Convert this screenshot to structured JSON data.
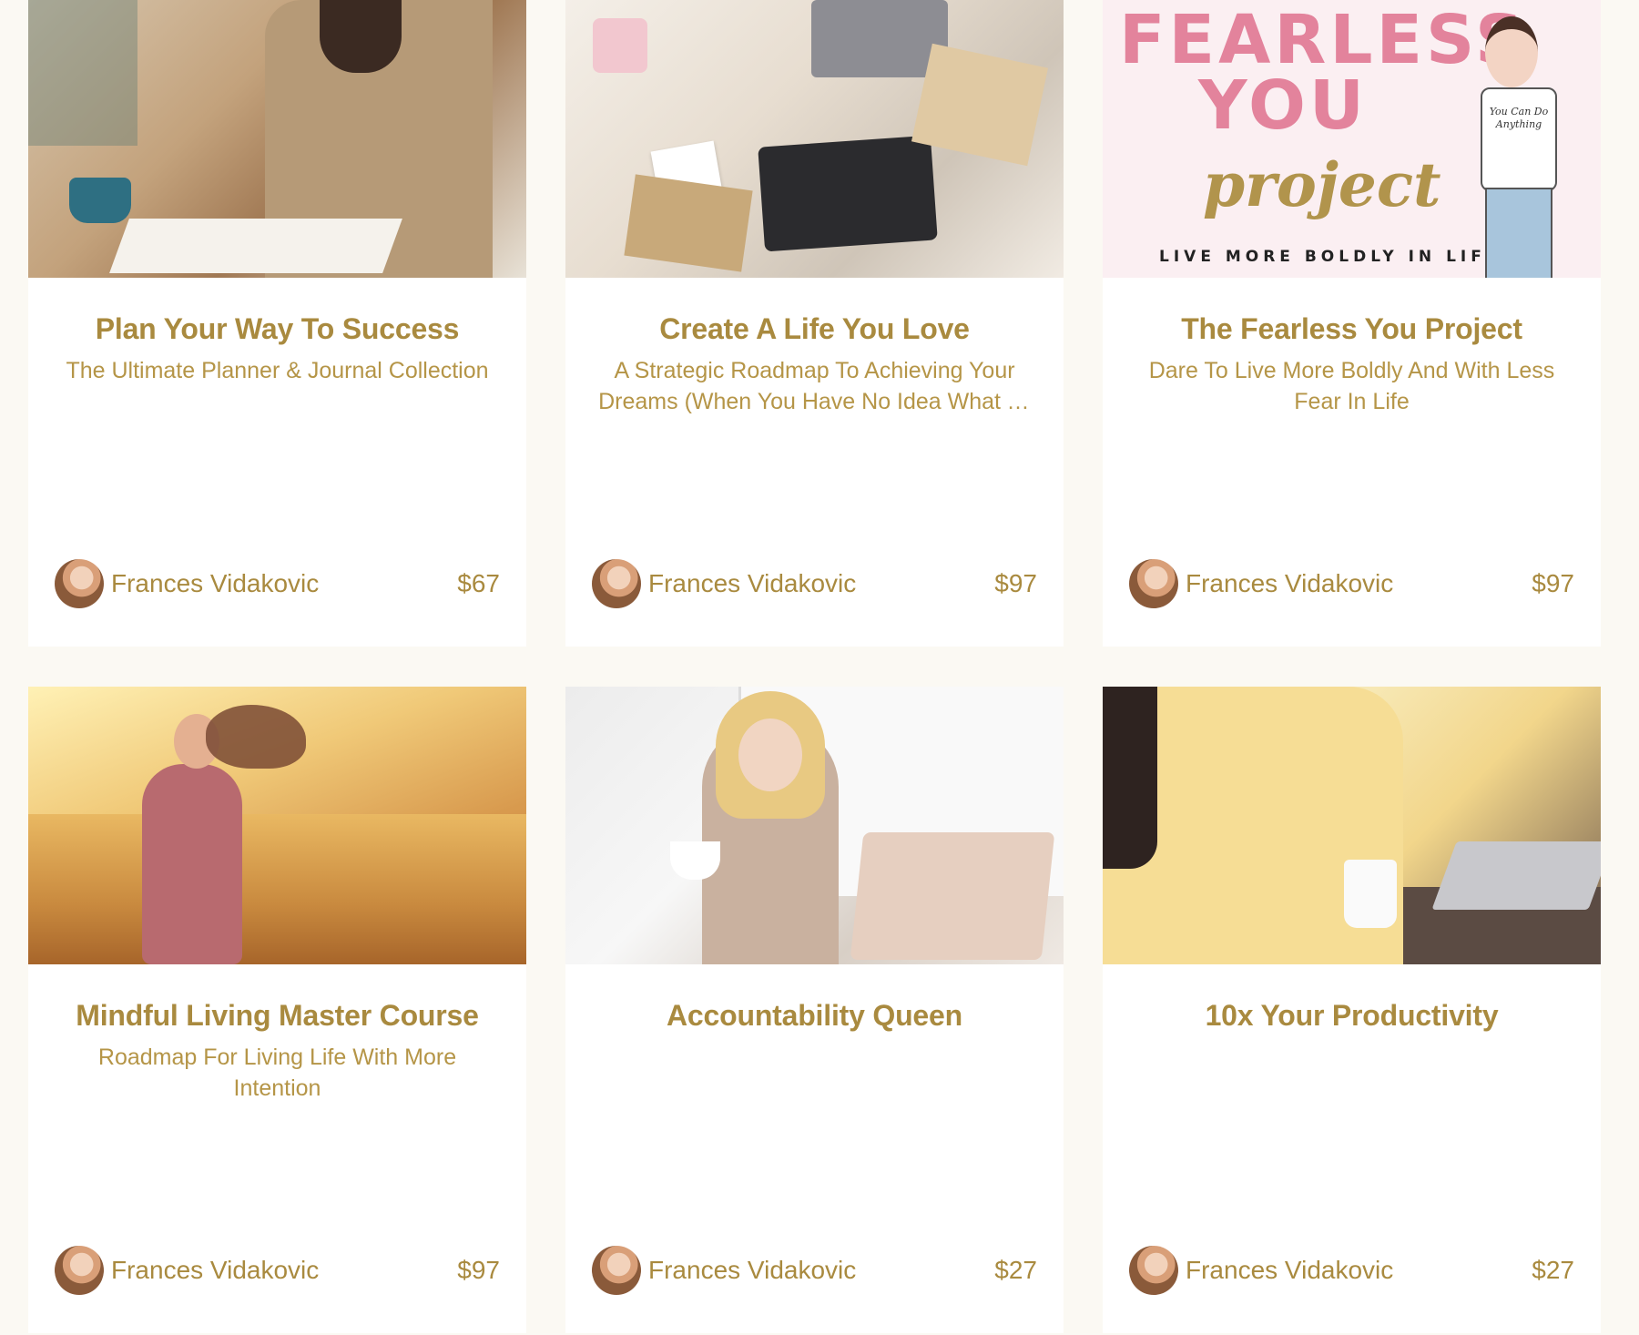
{
  "colors": {
    "page_background": "#fbf9f3",
    "card_background": "#ffffff",
    "accent_gold": "#a98a3f",
    "fearless_pink": "#e3839c"
  },
  "courses": [
    {
      "title": "Plan Your Way To Success",
      "subtitle": "The Ultimate Planner & Journal Collection",
      "author": "Frances Vidakovic",
      "price": "$67"
    },
    {
      "title": "Create A Life You Love",
      "subtitle": "A Strategic Roadmap To Achieving Your Dreams (When You Have No Idea What To Do)",
      "author": "Frances Vidakovic",
      "price": "$97"
    },
    {
      "title": "The Fearless You Project",
      "subtitle": "Dare To Live More Boldly And With Less Fear In Life",
      "author": "Frances Vidakovic",
      "price": "$97",
      "thumb_lines": {
        "line1": "FEARLESS",
        "line2": "YOU",
        "script": "project",
        "tagline": "LIVE MORE BOLDLY IN LIFE",
        "shirt": "You Can Do Anything"
      }
    },
    {
      "title": "Mindful Living Master Course",
      "subtitle": "Roadmap For Living Life With More Intention",
      "author": "Frances Vidakovic",
      "price": "$97"
    },
    {
      "title": "Accountability Queen",
      "subtitle": "",
      "author": "Frances Vidakovic",
      "price": "$27"
    },
    {
      "title": "10x Your Productivity",
      "subtitle": "",
      "author": "Frances Vidakovic",
      "price": "$27"
    }
  ]
}
